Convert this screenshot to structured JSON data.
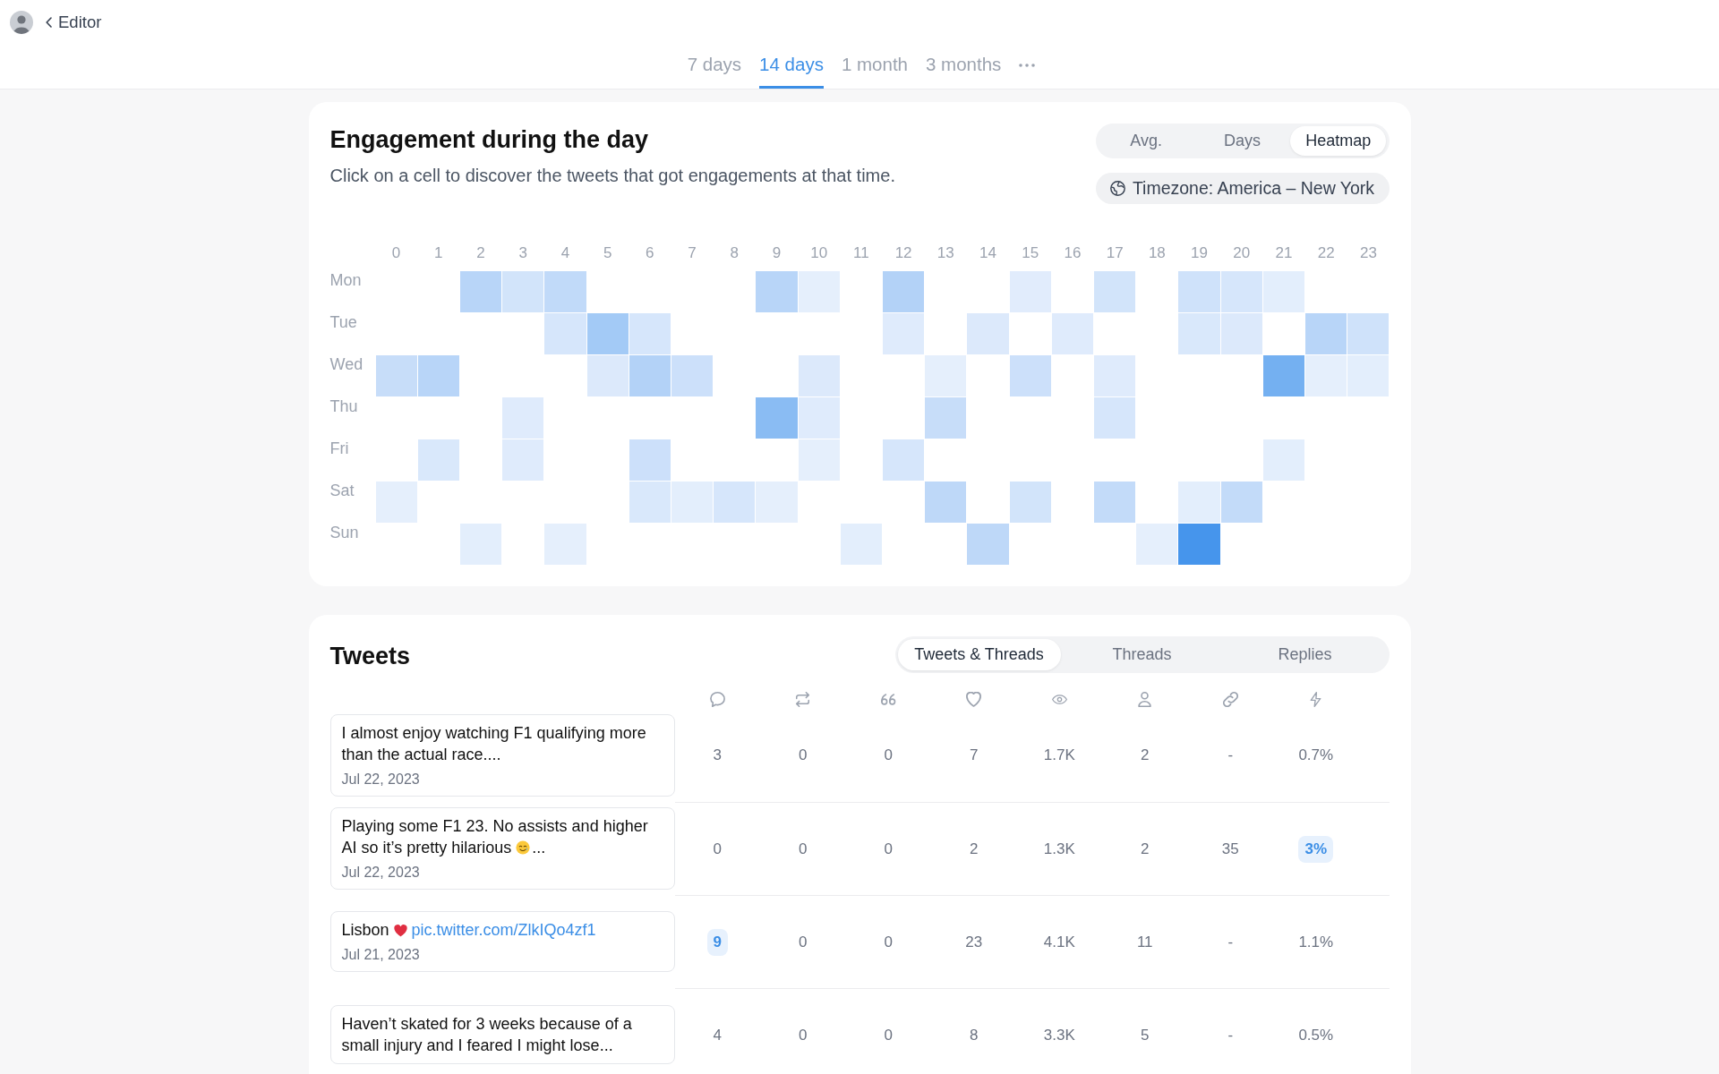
{
  "nav": {
    "back": "Editor",
    "ranges": [
      {
        "label": "7 days",
        "selected": false
      },
      {
        "label": "14 days",
        "selected": true
      },
      {
        "label": "1 month",
        "selected": false
      },
      {
        "label": "3 months",
        "selected": false
      }
    ]
  },
  "heatmap": {
    "title": "Engagement during the day",
    "subtitle": "Click on a cell to discover the tweets that got engagements at that time.",
    "views": [
      {
        "label": "Avg.",
        "selected": false
      },
      {
        "label": "Days",
        "selected": false
      },
      {
        "label": "Heatmap",
        "selected": true
      }
    ],
    "timezone": "Timezone: America – New York",
    "hours": [
      "0",
      "1",
      "2",
      "3",
      "4",
      "5",
      "6",
      "7",
      "8",
      "9",
      "10",
      "11",
      "12",
      "13",
      "14",
      "15",
      "16",
      "17",
      "18",
      "19",
      "20",
      "21",
      "22",
      "23"
    ],
    "rows": [
      {
        "day": "Mon",
        "cells": [
          {
            "filled": false
          },
          {
            "filled": false
          },
          {
            "filled": true,
            "color": "#b8d5f8"
          },
          {
            "filled": true,
            "color": "#d2e4fa"
          },
          {
            "filled": true,
            "color": "#c1daf9"
          },
          {
            "filled": false
          },
          {
            "filled": false
          },
          {
            "filled": false
          },
          {
            "filled": false
          },
          {
            "filled": true,
            "color": "#b8d5f8"
          },
          {
            "filled": true,
            "color": "#e5effc"
          },
          {
            "filled": false
          },
          {
            "filled": true,
            "color": "#b3d2f7"
          },
          {
            "filled": false
          },
          {
            "filled": false
          },
          {
            "filled": true,
            "color": "#e1ecfc"
          },
          {
            "filled": false
          },
          {
            "filled": true,
            "color": "#d2e4fa"
          },
          {
            "filled": false
          },
          {
            "filled": true,
            "color": "#cfe2fa"
          },
          {
            "filled": true,
            "color": "#d6e6fb"
          },
          {
            "filled": true,
            "color": "#e3eefc"
          },
          {
            "filled": false
          },
          {
            "filled": false
          }
        ]
      },
      {
        "day": "Tue",
        "cells": [
          {
            "filled": false
          },
          {
            "filled": false
          },
          {
            "filled": false
          },
          {
            "filled": false
          },
          {
            "filled": true,
            "color": "#d6e6fb"
          },
          {
            "filled": true,
            "color": "#a3caf6"
          },
          {
            "filled": true,
            "color": "#d6e6fb"
          },
          {
            "filled": false
          },
          {
            "filled": false
          },
          {
            "filled": false
          },
          {
            "filled": false
          },
          {
            "filled": false
          },
          {
            "filled": true,
            "color": "#dfebfc"
          },
          {
            "filled": false
          },
          {
            "filled": true,
            "color": "#dce9fb"
          },
          {
            "filled": false
          },
          {
            "filled": true,
            "color": "#dfebfc"
          },
          {
            "filled": false
          },
          {
            "filled": false
          },
          {
            "filled": true,
            "color": "#d9e8fb"
          },
          {
            "filled": true,
            "color": "#dce9fb"
          },
          {
            "filled": false
          },
          {
            "filled": true,
            "color": "#b8d5f8"
          },
          {
            "filled": true,
            "color": "#cfe2fa"
          }
        ]
      },
      {
        "day": "Wed",
        "cells": [
          {
            "filled": true,
            "color": "#c7ddf9"
          },
          {
            "filled": true,
            "color": "#b8d5f8"
          },
          {
            "filled": false
          },
          {
            "filled": false
          },
          {
            "filled": false
          },
          {
            "filled": true,
            "color": "#dce9fb"
          },
          {
            "filled": true,
            "color": "#b3d2f7"
          },
          {
            "filled": true,
            "color": "#cce0fa"
          },
          {
            "filled": false
          },
          {
            "filled": false
          },
          {
            "filled": true,
            "color": "#dce9fb"
          },
          {
            "filled": false
          },
          {
            "filled": false
          },
          {
            "filled": true,
            "color": "#e5effc"
          },
          {
            "filled": false
          },
          {
            "filled": true,
            "color": "#cce0fa"
          },
          {
            "filled": false
          },
          {
            "filled": true,
            "color": "#dfebfc"
          },
          {
            "filled": false
          },
          {
            "filled": false
          },
          {
            "filled": false
          },
          {
            "filled": true,
            "color": "#74b0f1"
          },
          {
            "filled": true,
            "color": "#e5effc"
          },
          {
            "filled": true,
            "color": "#e3eefc"
          }
        ]
      },
      {
        "day": "Thu",
        "cells": [
          {
            "filled": false
          },
          {
            "filled": false
          },
          {
            "filled": false
          },
          {
            "filled": true,
            "color": "#dfebfc"
          },
          {
            "filled": false
          },
          {
            "filled": false
          },
          {
            "filled": false
          },
          {
            "filled": false
          },
          {
            "filled": false
          },
          {
            "filled": true,
            "color": "#8abcf3"
          },
          {
            "filled": true,
            "color": "#dfebfc"
          },
          {
            "filled": false
          },
          {
            "filled": false
          },
          {
            "filled": true,
            "color": "#c7ddf9"
          },
          {
            "filled": false
          },
          {
            "filled": false
          },
          {
            "filled": false
          },
          {
            "filled": true,
            "color": "#d6e6fb"
          },
          {
            "filled": false
          },
          {
            "filled": false
          },
          {
            "filled": false
          },
          {
            "filled": false
          },
          {
            "filled": false
          },
          {
            "filled": false
          }
        ]
      },
      {
        "day": "Fri",
        "cells": [
          {
            "filled": false
          },
          {
            "filled": true,
            "color": "#d9e8fb"
          },
          {
            "filled": false
          },
          {
            "filled": true,
            "color": "#dfebfc"
          },
          {
            "filled": false
          },
          {
            "filled": false
          },
          {
            "filled": true,
            "color": "#cce0fa"
          },
          {
            "filled": false
          },
          {
            "filled": false
          },
          {
            "filled": false
          },
          {
            "filled": true,
            "color": "#e5effc"
          },
          {
            "filled": false
          },
          {
            "filled": true,
            "color": "#d6e6fb"
          },
          {
            "filled": false
          },
          {
            "filled": false
          },
          {
            "filled": false
          },
          {
            "filled": false
          },
          {
            "filled": false
          },
          {
            "filled": false
          },
          {
            "filled": false
          },
          {
            "filled": false
          },
          {
            "filled": true,
            "color": "#e3eefc"
          },
          {
            "filled": false
          },
          {
            "filled": false
          }
        ]
      },
      {
        "day": "Sat",
        "cells": [
          {
            "filled": true,
            "color": "#e5effc"
          },
          {
            "filled": false
          },
          {
            "filled": false
          },
          {
            "filled": false
          },
          {
            "filled": false
          },
          {
            "filled": false
          },
          {
            "filled": true,
            "color": "#d9e8fb"
          },
          {
            "filled": true,
            "color": "#e3eefc"
          },
          {
            "filled": true,
            "color": "#d6e6fb"
          },
          {
            "filled": true,
            "color": "#e5effc"
          },
          {
            "filled": false
          },
          {
            "filled": false
          },
          {
            "filled": false
          },
          {
            "filled": true,
            "color": "#bed8f8"
          },
          {
            "filled": false
          },
          {
            "filled": true,
            "color": "#d2e4fa"
          },
          {
            "filled": false
          },
          {
            "filled": true,
            "color": "#c3dbf9"
          },
          {
            "filled": false
          },
          {
            "filled": true,
            "color": "#e3eefc"
          },
          {
            "filled": true,
            "color": "#c3dbf9"
          },
          {
            "filled": false
          },
          {
            "filled": false
          },
          {
            "filled": false
          }
        ]
      },
      {
        "day": "Sun",
        "cells": [
          {
            "filled": false
          },
          {
            "filled": false
          },
          {
            "filled": true,
            "color": "#e3eefc"
          },
          {
            "filled": false
          },
          {
            "filled": true,
            "color": "#e5effc"
          },
          {
            "filled": false
          },
          {
            "filled": false
          },
          {
            "filled": false
          },
          {
            "filled": false
          },
          {
            "filled": false
          },
          {
            "filled": false
          },
          {
            "filled": true,
            "color": "#e3eefc"
          },
          {
            "filled": false
          },
          {
            "filled": false
          },
          {
            "filled": true,
            "color": "#bed8f8"
          },
          {
            "filled": false
          },
          {
            "filled": false
          },
          {
            "filled": false
          },
          {
            "filled": true,
            "color": "#e5effc"
          },
          {
            "filled": true,
            "color": "#4695ec"
          },
          {
            "filled": false
          },
          {
            "filled": false
          },
          {
            "filled": false
          },
          {
            "filled": false
          }
        ]
      }
    ]
  },
  "tweets": {
    "title": "Tweets",
    "filters": [
      {
        "label": "Tweets & Threads",
        "selected": true
      },
      {
        "label": "Threads",
        "selected": false
      },
      {
        "label": "Replies",
        "selected": false
      }
    ],
    "rows": [
      {
        "parts": [
          {
            "kind": "text",
            "text": "I almost enjoy watching F1 qualifying more than the actual race...."
          }
        ],
        "date": "Jul 22, 2023",
        "metrics": [
          {
            "value": "3",
            "highlighted": false
          },
          {
            "value": "0",
            "highlighted": false
          },
          {
            "value": "0",
            "highlighted": false
          },
          {
            "value": "7",
            "highlighted": false
          },
          {
            "value": "1.7K",
            "highlighted": false
          },
          {
            "value": "2",
            "highlighted": false
          },
          {
            "value": "-",
            "highlighted": false
          },
          {
            "value": "0.7%",
            "highlighted": false
          }
        ]
      },
      {
        "parts": [
          {
            "kind": "text",
            "text": "Playing some F1 23. No assists and higher AI so it’s pretty hilarious"
          },
          {
            "kind": "face"
          },
          {
            "kind": "text",
            "text": "..."
          }
        ],
        "date": "Jul 22, 2023",
        "metrics": [
          {
            "value": "0",
            "highlighted": false
          },
          {
            "value": "0",
            "highlighted": false
          },
          {
            "value": "0",
            "highlighted": false
          },
          {
            "value": "2",
            "highlighted": false
          },
          {
            "value": "1.3K",
            "highlighted": false
          },
          {
            "value": "2",
            "highlighted": false
          },
          {
            "value": "35",
            "highlighted": false
          },
          {
            "value": "3%",
            "highlighted": true
          }
        ]
      },
      {
        "parts": [
          {
            "kind": "text",
            "text": "Lisbon"
          },
          {
            "kind": "heart"
          },
          {
            "kind": "link",
            "text": "pic.twitter.com/ZlkIQo4zf1"
          }
        ],
        "date": "Jul 21, 2023",
        "metrics": [
          {
            "value": "9",
            "highlighted": true
          },
          {
            "value": "0",
            "highlighted": false
          },
          {
            "value": "0",
            "highlighted": false
          },
          {
            "value": "23",
            "highlighted": false
          },
          {
            "value": "4.1K",
            "highlighted": false
          },
          {
            "value": "11",
            "highlighted": false
          },
          {
            "value": "-",
            "highlighted": false
          },
          {
            "value": "1.1%",
            "highlighted": false
          }
        ]
      },
      {
        "parts": [
          {
            "kind": "text",
            "text": "Haven’t skated for 3 weeks because of a small injury and I feared I might lose..."
          }
        ],
        "metrics": [
          {
            "value": "4",
            "highlighted": false
          },
          {
            "value": "0",
            "highlighted": false
          },
          {
            "value": "0",
            "highlighted": false
          },
          {
            "value": "8",
            "highlighted": false
          },
          {
            "value": "3.3K",
            "highlighted": false
          },
          {
            "value": "5",
            "highlighted": false
          },
          {
            "value": "-",
            "highlighted": false
          },
          {
            "value": "0.5%",
            "highlighted": false
          }
        ]
      }
    ]
  }
}
